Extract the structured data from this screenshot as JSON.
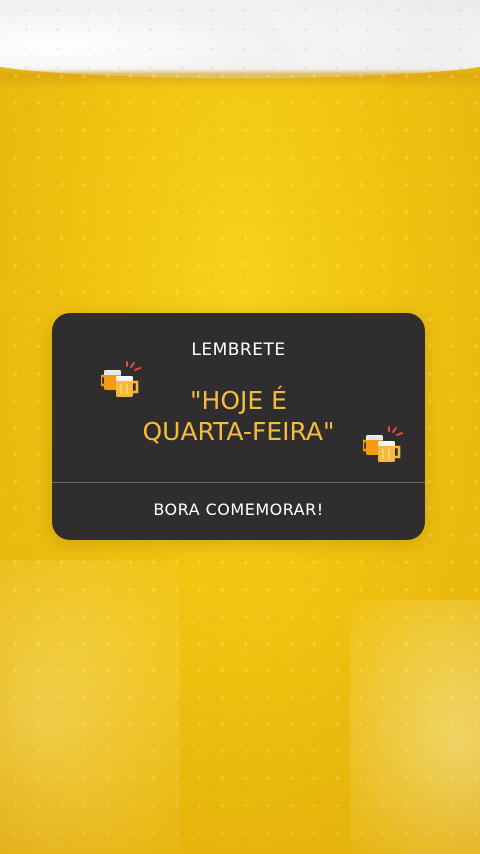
{
  "story": {
    "background": "beer-glass-foam",
    "card": {
      "label": "LEMBRETE",
      "headline_line1": "\"HOJE É",
      "headline_line2": "QUARTA-FEIRA\"",
      "footer": "BORA COMEMORAR!",
      "icons": [
        "beer-mugs-icon",
        "beer-mugs-icon"
      ]
    }
  },
  "colors": {
    "card_bg": "#2f2d2d",
    "headline": "#f5bb3b",
    "label": "#ffffff",
    "beer": "#f0c311",
    "foam": "#f0f0f0"
  }
}
